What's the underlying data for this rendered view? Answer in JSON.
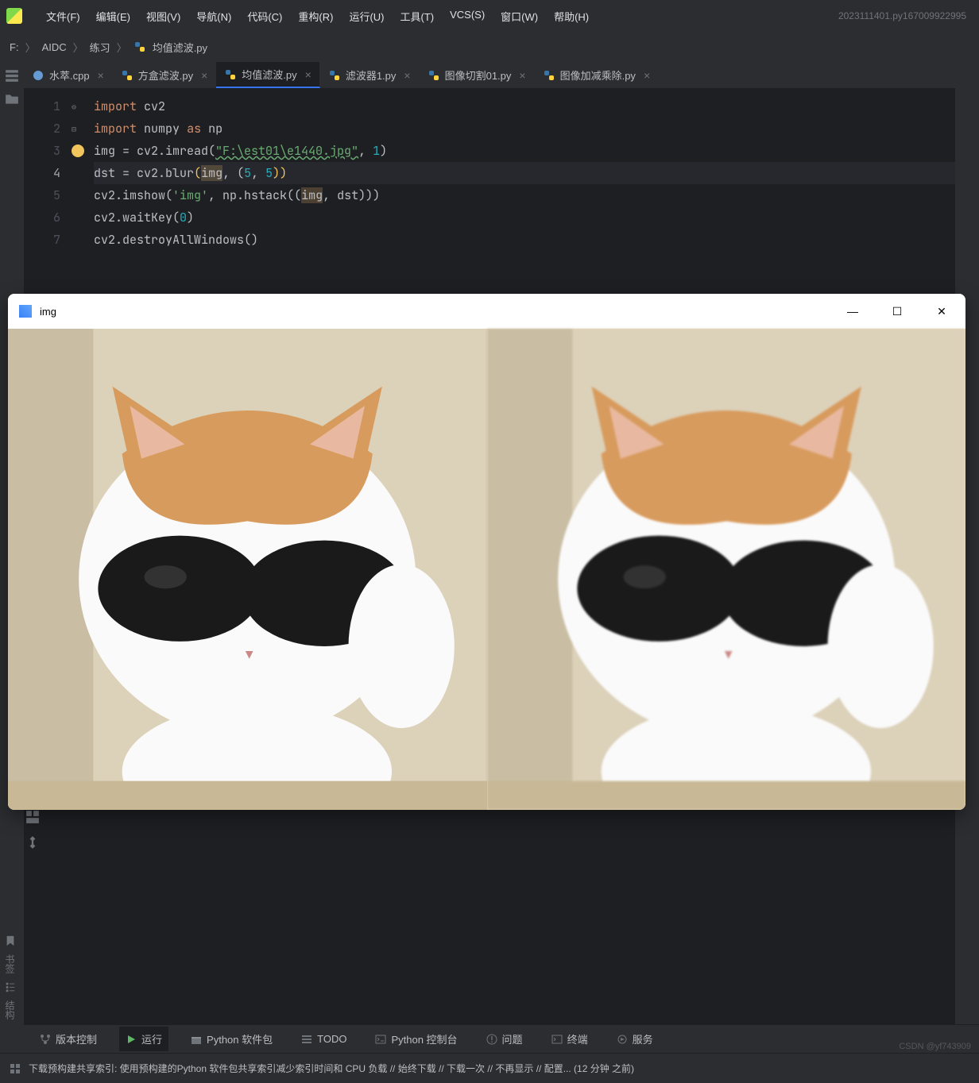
{
  "titlebar": {
    "menus": [
      "文件(F)",
      "编辑(E)",
      "视图(V)",
      "导航(N)",
      "代码(C)",
      "重构(R)",
      "运行(U)",
      "工具(T)",
      "VCS(S)",
      "窗口(W)",
      "帮助(H)"
    ],
    "right": "2023111401.py167009922995"
  },
  "breadcrumb": {
    "parts": [
      "F:",
      "AIDC",
      "练习",
      "均值滤波.py"
    ]
  },
  "tabs": [
    {
      "label": "水萃.cpp",
      "icon": "cpp",
      "active": false
    },
    {
      "label": "方盒滤波.py",
      "icon": "py",
      "active": false
    },
    {
      "label": "均值滤波.py",
      "icon": "py",
      "active": true
    },
    {
      "label": "滤波器1.py",
      "icon": "py",
      "active": false
    },
    {
      "label": "图像切割01.py",
      "icon": "py",
      "active": false
    },
    {
      "label": "图像加减乘除.py",
      "icon": "py",
      "active": false
    }
  ],
  "code": {
    "lines": [
      "1",
      "2",
      "3",
      "4",
      "5",
      "6",
      "7"
    ],
    "active_line": "4",
    "l1": {
      "kw": "import",
      "mod": "cv2"
    },
    "l2": {
      "kw": "import",
      "mod": "numpy",
      "as": "as",
      "alias": "np"
    },
    "l3": {
      "var": "img",
      "eq": " = ",
      "call": "cv2.imread(",
      "str": "\"F:\\est01\\e1440.jpg\"",
      "comma": ", ",
      "num": "1",
      "close": ")"
    },
    "l4": {
      "var": "dst",
      "eq": " = ",
      "call": "cv2.blur",
      "open": "(",
      "arg1": "img",
      "c1": ", (",
      "n1": "5",
      "c2": ", ",
      "n2": "5",
      "close": "))"
    },
    "l5": {
      "call": "cv2.imshow(",
      "str": "'img'",
      "c": ", ",
      "np": "np.hstack((",
      "arg": "img",
      "c2": ", dst)))"
    },
    "l6": {
      "call": "cv2.waitKey(",
      "num": "0",
      "close": ")"
    },
    "l7": {
      "call": "cv2.destroyAllWindows(",
      ")": ")"
    }
  },
  "cvwindow": {
    "title": "img"
  },
  "bottom_tabs": [
    {
      "icon": "branch",
      "label": "版本控制"
    },
    {
      "icon": "play",
      "label": "运行",
      "active": true
    },
    {
      "icon": "package",
      "label": "Python 软件包"
    },
    {
      "icon": "todo",
      "label": "TODO"
    },
    {
      "icon": "console",
      "label": "Python 控制台"
    },
    {
      "icon": "problem",
      "label": "问题"
    },
    {
      "icon": "terminal",
      "label": "终端"
    },
    {
      "icon": "services",
      "label": "服务"
    }
  ],
  "status": {
    "msg": "下载预构建共享索引: 使用预构建的Python 软件包共享索引减少索引时间和 CPU 负载 // 始终下载 // 下载一次 // 不再显示 // 配置... (12 分钟 之前)"
  },
  "watermark": "CSDN @yf743909",
  "left_vert": [
    "书签",
    "结构"
  ]
}
